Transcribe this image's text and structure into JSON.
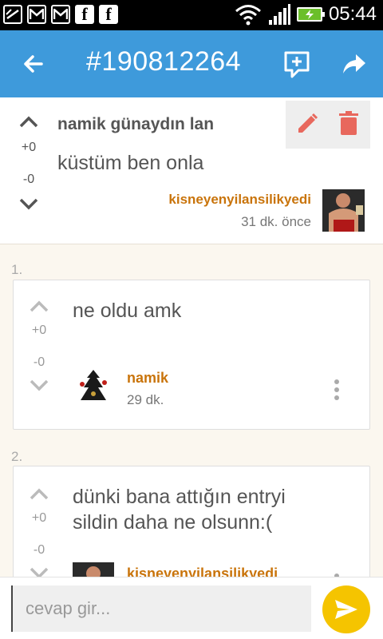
{
  "status_bar": {
    "time": "05:44",
    "left_icons": [
      "notification-icon",
      "gmail-icon",
      "gmail-icon",
      "facebook-icon",
      "facebook-icon"
    ],
    "right_icons": [
      "wifi-icon",
      "signal-icon",
      "battery-charging-icon"
    ]
  },
  "app_bar": {
    "title": "#190812264",
    "color": "#3e9adb"
  },
  "post": {
    "title": "namik günaydın lan",
    "body": "küstüm ben onla",
    "upvotes": "+0",
    "downvotes": "-0",
    "author": "kisneyenyilansilikyedi",
    "time": "31 dk. önce"
  },
  "comments": [
    {
      "index": "1.",
      "text_lines": [
        "ne oldu amk"
      ],
      "upvotes": "+0",
      "downvotes": "-0",
      "author": "namik",
      "time": "29 dk."
    },
    {
      "index": "2.",
      "text_lines": [
        "dünki bana attığın entryi",
        "sildin daha ne olsunn:("
      ],
      "upvotes": "+0",
      "downvotes": "-0",
      "author": "kisneyenyilansilikyedi",
      "time": ""
    }
  ],
  "reply": {
    "placeholder": "cevap gir..."
  },
  "colors": {
    "accent": "#3e9adb",
    "author": "#c9740b",
    "send": "#f5c400",
    "background": "#fbf7ef"
  }
}
